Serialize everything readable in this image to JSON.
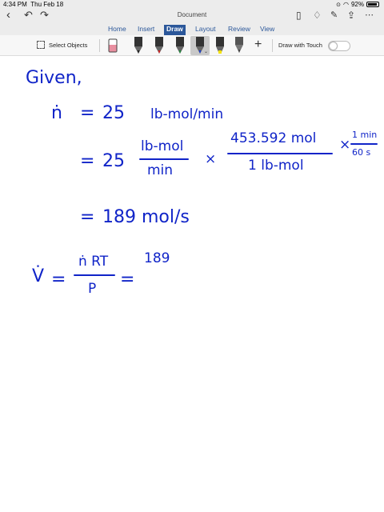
{
  "status_bar": {
    "time": "4:34 PM",
    "date": "Thu Feb 18",
    "battery": "92%"
  },
  "window": {
    "title": "Document"
  },
  "tabs": [
    {
      "label": "Home"
    },
    {
      "label": "Insert"
    },
    {
      "label": "Draw",
      "active": true
    },
    {
      "label": "Layout"
    },
    {
      "label": "Review"
    },
    {
      "label": "View"
    }
  ],
  "ribbon": {
    "select_objects_label": "Select Objects",
    "draw_with_touch_label": "Draw with Touch",
    "draw_with_touch_on": false,
    "tools": [
      {
        "name": "eraser",
        "color": "#e98fa0"
      },
      {
        "name": "pen-black",
        "color": "#222222"
      },
      {
        "name": "pen-red",
        "color": "#d32020"
      },
      {
        "name": "pen-green",
        "color": "#1f8a3a"
      },
      {
        "name": "pen-blue",
        "color": "#1a3ecf",
        "selected": true
      },
      {
        "name": "highlighter-yellow",
        "color": "#f4e200"
      },
      {
        "name": "pencil-dark",
        "color": "#444444"
      }
    ]
  },
  "handwriting": {
    "given": "Given,",
    "line1_lhs": "ṅ",
    "eq": "=",
    "line1_val": "25",
    "line1_unit": "lb-mol/min",
    "line2_num_unit": "lb-mol",
    "line2_den_unit": "min",
    "times": "×",
    "conv1_num": "453.592 mol",
    "conv1_den": "1 lb-mol",
    "conv2_num": "1 min",
    "conv2_den": "60 s",
    "line3_val": "189 mol/s",
    "v_lhs": "V̇",
    "v_frac_num": "ṅ RT",
    "v_frac_den": "P",
    "v_partial": "189"
  }
}
